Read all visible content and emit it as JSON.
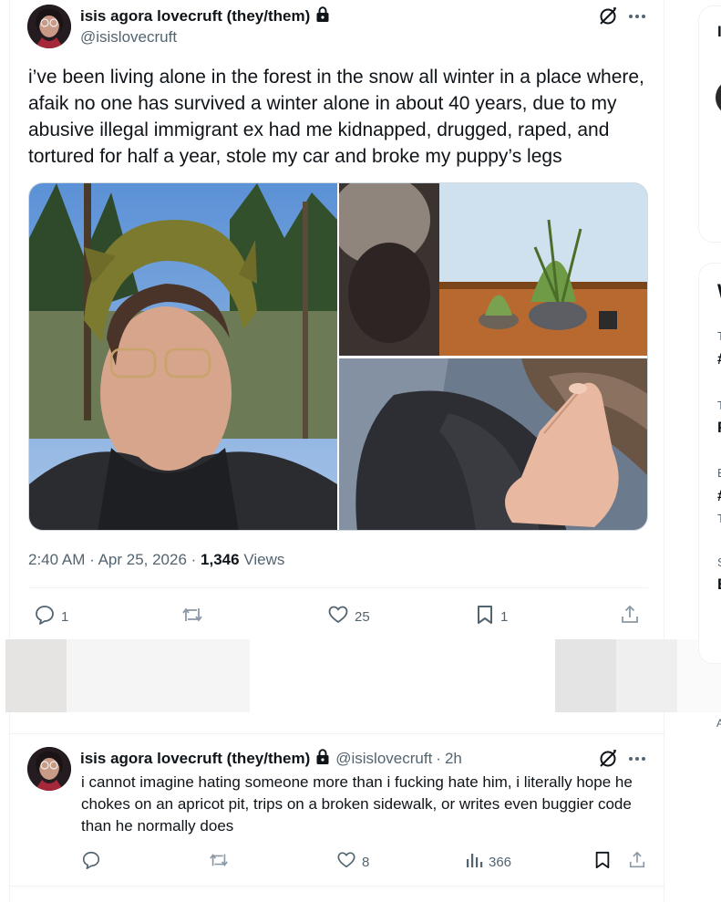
{
  "tweet": {
    "author_name": "isis agora lovecruft (they/them)",
    "handle": "@isislovecruft",
    "text": "i’ve been living alone in the forest in the snow all winter in a place where, afaik no one has survived a winter alone in about 40 years, due to my abusive illegal immigrant ex had me kidnapped, drugged, raped, and tortured for half a year, stole my car and broke my puppy’s legs",
    "time": "2:40 AM",
    "date": "Apr 25, 2026",
    "views_count": "1,346",
    "views_label": "Views",
    "replies": "1",
    "retweets": "",
    "likes": "25",
    "bookmarks": "1"
  },
  "reply": {
    "author_name": "isis agora lovecruft (they/them)",
    "handle": "@isislovecruft",
    "sep": "·",
    "age": "2h",
    "text": "i cannot imagine hating someone more than i fucking hate him, i literally hope he chokes on an apricot pit, trips on a broken sidewalk, or writes even buggier code than he normally does",
    "replies": "",
    "retweets": "",
    "likes": "8",
    "views": "366"
  },
  "right_column": {
    "chars": [
      "I",
      "W",
      "T",
      "#",
      "T",
      "F",
      "E",
      "#",
      "T",
      "S",
      "E",
      "A"
    ]
  },
  "icons": [
    "lock-icon",
    "grok-icon",
    "more-icon",
    "reply-icon",
    "retweet-icon",
    "like-icon",
    "bookmark-icon",
    "share-icon",
    "views-icon"
  ],
  "colors": {
    "text": "#0f1419",
    "secondary": "#536471",
    "border": "#eff3f4",
    "link": "#1d9bf0"
  }
}
